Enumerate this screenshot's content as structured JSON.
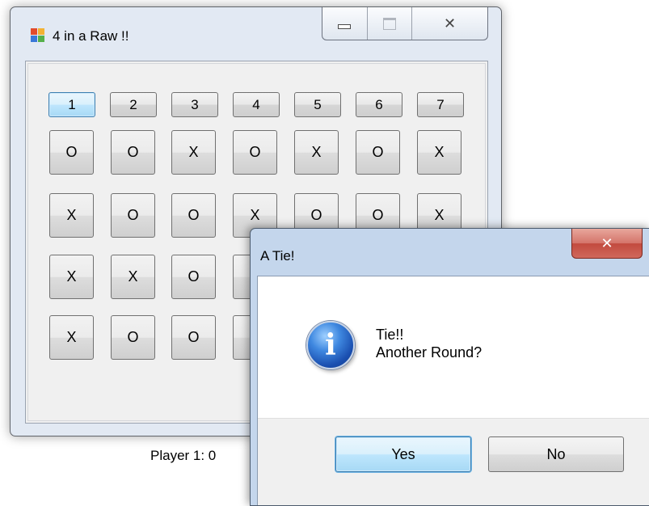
{
  "main_window": {
    "title": "4 in a Raw !!",
    "caption": {
      "minimize": "minimize-icon",
      "maximize": "maximize-icon",
      "close": "✕"
    },
    "column_buttons": [
      "1",
      "2",
      "3",
      "4",
      "5",
      "6",
      "7"
    ],
    "focused_column": 0,
    "grid": [
      [
        "O",
        "O",
        "X",
        "O",
        "X",
        "O",
        "X"
      ],
      [
        "X",
        "O",
        "O",
        "X",
        "O",
        "O",
        "X"
      ],
      [
        "X",
        "X",
        "O",
        "",
        "",
        "",
        ""
      ],
      [
        "X",
        "O",
        "O",
        "",
        "",
        "",
        ""
      ]
    ],
    "score_label": "Player 1: 0"
  },
  "dialog": {
    "title": "A Tie!",
    "close_glyph": "✕",
    "icon": "info-icon",
    "icon_glyph": "i",
    "message_line1": "Tie!!",
    "message_line2": "Another Round?",
    "yes_label": "Yes",
    "no_label": "No"
  },
  "colors": {
    "window_frame": "#e2e9f3",
    "dialog_frame": "#c4d6ec",
    "focus_border": "#3c7fb1",
    "close_red": "#c24a3e"
  }
}
